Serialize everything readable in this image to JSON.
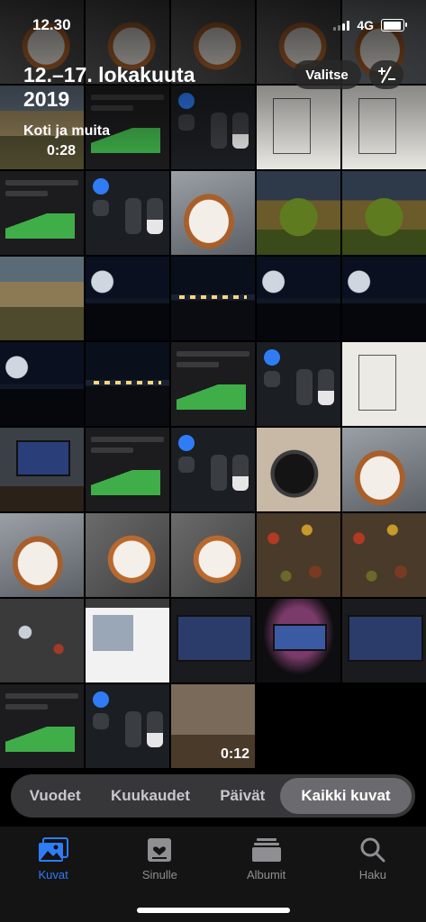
{
  "status_bar": {
    "time": "12.30",
    "network": "4G"
  },
  "header": {
    "title": "12.–17. lokakuuta 2019",
    "subtitle": "Koti ja muita",
    "first_item_duration": "0:28",
    "select_label": "Valitse"
  },
  "grid": {
    "video_durations": {
      "row8_col3": "0:12"
    }
  },
  "segments": {
    "items": [
      "Vuodet",
      "Kuukaudet",
      "Päivät",
      "Kaikki kuvat"
    ],
    "selected": "Kaikki kuvat"
  },
  "tabbar": {
    "items": [
      {
        "label": "Kuvat",
        "icon": "photos-icon",
        "active": true
      },
      {
        "label": "Sinulle",
        "icon": "for-you-icon",
        "active": false
      },
      {
        "label": "Albumit",
        "icon": "albums-icon",
        "active": false
      },
      {
        "label": "Haku",
        "icon": "search-icon",
        "active": false
      }
    ],
    "active_color": "#2f7cf6"
  }
}
